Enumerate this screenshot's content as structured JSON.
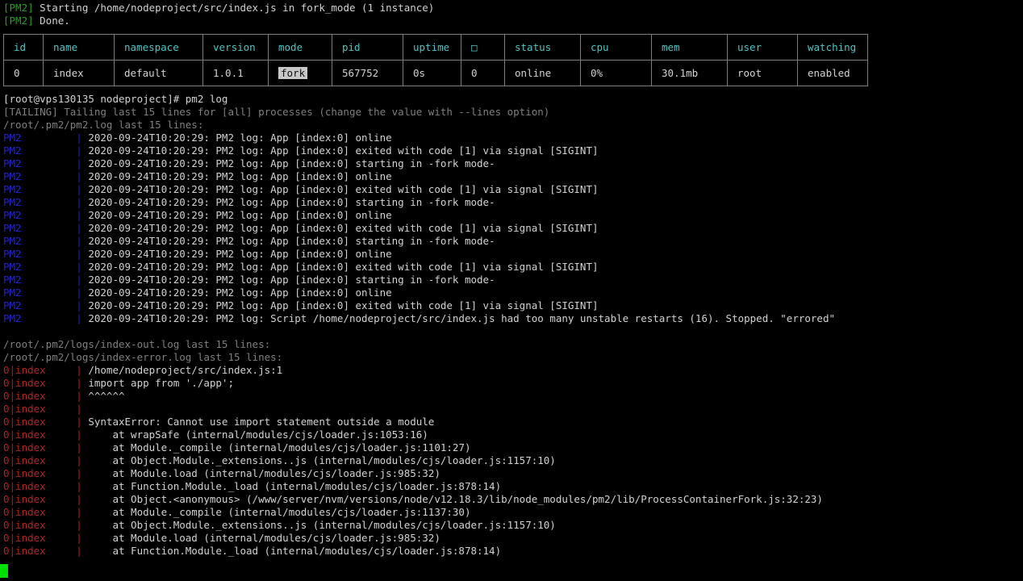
{
  "colors": {
    "background": "#000000",
    "foreground": "#d2d2d2",
    "green": "#21a421",
    "cyan": "#4fc3c3",
    "dim_gray": "#7f7f7f",
    "pm2_blue": "#2424cc",
    "error_red": "#b42222",
    "cursor_green": "#00e000",
    "table_border": "#7d7d7d",
    "highlight_bg": "#c8c8c8"
  },
  "startup": {
    "prefix": "[PM2] ",
    "line1": "Starting /home/nodeproject/src/index.js in fork_mode (1 instance)",
    "line2": "Done."
  },
  "process_table": {
    "headers": [
      "id",
      "name",
      "namespace",
      "version",
      "mode",
      "pid",
      "uptime",
      "□",
      "status",
      "cpu",
      "mem",
      "user",
      "watching"
    ],
    "row": {
      "id": "0",
      "name": "index",
      "namespace": "default",
      "version": "1.0.1",
      "mode": "fork",
      "pid": "567752",
      "uptime": "0s",
      "restarts": "0",
      "status": "online",
      "cpu": "0%",
      "mem": "30.1mb",
      "user": "root",
      "watching": "enabled"
    }
  },
  "prompt": {
    "label": "[root@vps130135 nodeproject]# ",
    "command": "pm2 log"
  },
  "tailing_line": "[TAILING] Tailing last 15 lines for [all] processes (change the value with --lines option)",
  "pm2_log": {
    "header": "/root/.pm2/pm2.log last 15 lines:",
    "line_prefix": "PM2         | ",
    "lines": [
      "2020-09-24T10:20:29: PM2 log: App [index:0] online",
      "2020-09-24T10:20:29: PM2 log: App [index:0] exited with code [1] via signal [SIGINT]",
      "2020-09-24T10:20:29: PM2 log: App [index:0] starting in -fork mode-",
      "2020-09-24T10:20:29: PM2 log: App [index:0] online",
      "2020-09-24T10:20:29: PM2 log: App [index:0] exited with code [1] via signal [SIGINT]",
      "2020-09-24T10:20:29: PM2 log: App [index:0] starting in -fork mode-",
      "2020-09-24T10:20:29: PM2 log: App [index:0] online",
      "2020-09-24T10:20:29: PM2 log: App [index:0] exited with code [1] via signal [SIGINT]",
      "2020-09-24T10:20:29: PM2 log: App [index:0] starting in -fork mode-",
      "2020-09-24T10:20:29: PM2 log: App [index:0] online",
      "2020-09-24T10:20:29: PM2 log: App [index:0] exited with code [1] via signal [SIGINT]",
      "2020-09-24T10:20:29: PM2 log: App [index:0] starting in -fork mode-",
      "2020-09-24T10:20:29: PM2 log: App [index:0] online",
      "2020-09-24T10:20:29: PM2 log: App [index:0] exited with code [1] via signal [SIGINT]",
      "2020-09-24T10:20:29: PM2 log: Script /home/nodeproject/src/index.js had too many unstable restarts (16). Stopped. \"errored\""
    ]
  },
  "out_log_header": "/root/.pm2/logs/index-out.log last 15 lines:",
  "error_log": {
    "header": "/root/.pm2/logs/index-error.log last 15 lines:",
    "line_prefix": "0|index     | ",
    "lines": [
      "/home/nodeproject/src/index.js:1",
      "import app from './app';",
      "^^^^^^",
      "",
      "SyntaxError: Cannot use import statement outside a module",
      "    at wrapSafe (internal/modules/cjs/loader.js:1053:16)",
      "    at Module._compile (internal/modules/cjs/loader.js:1101:27)",
      "    at Object.Module._extensions..js (internal/modules/cjs/loader.js:1157:10)",
      "    at Module.load (internal/modules/cjs/loader.js:985:32)",
      "    at Function.Module._load (internal/modules/cjs/loader.js:878:14)",
      "    at Object.<anonymous> (/www/server/nvm/versions/node/v12.18.3/lib/node_modules/pm2/lib/ProcessContainerFork.js:32:23)",
      "    at Module._compile (internal/modules/cjs/loader.js:1137:30)",
      "    at Object.Module._extensions..js (internal/modules/cjs/loader.js:1157:10)",
      "    at Module.load (internal/modules/cjs/loader.js:985:32)",
      "    at Function.Module._load (internal/modules/cjs/loader.js:878:14)"
    ]
  }
}
